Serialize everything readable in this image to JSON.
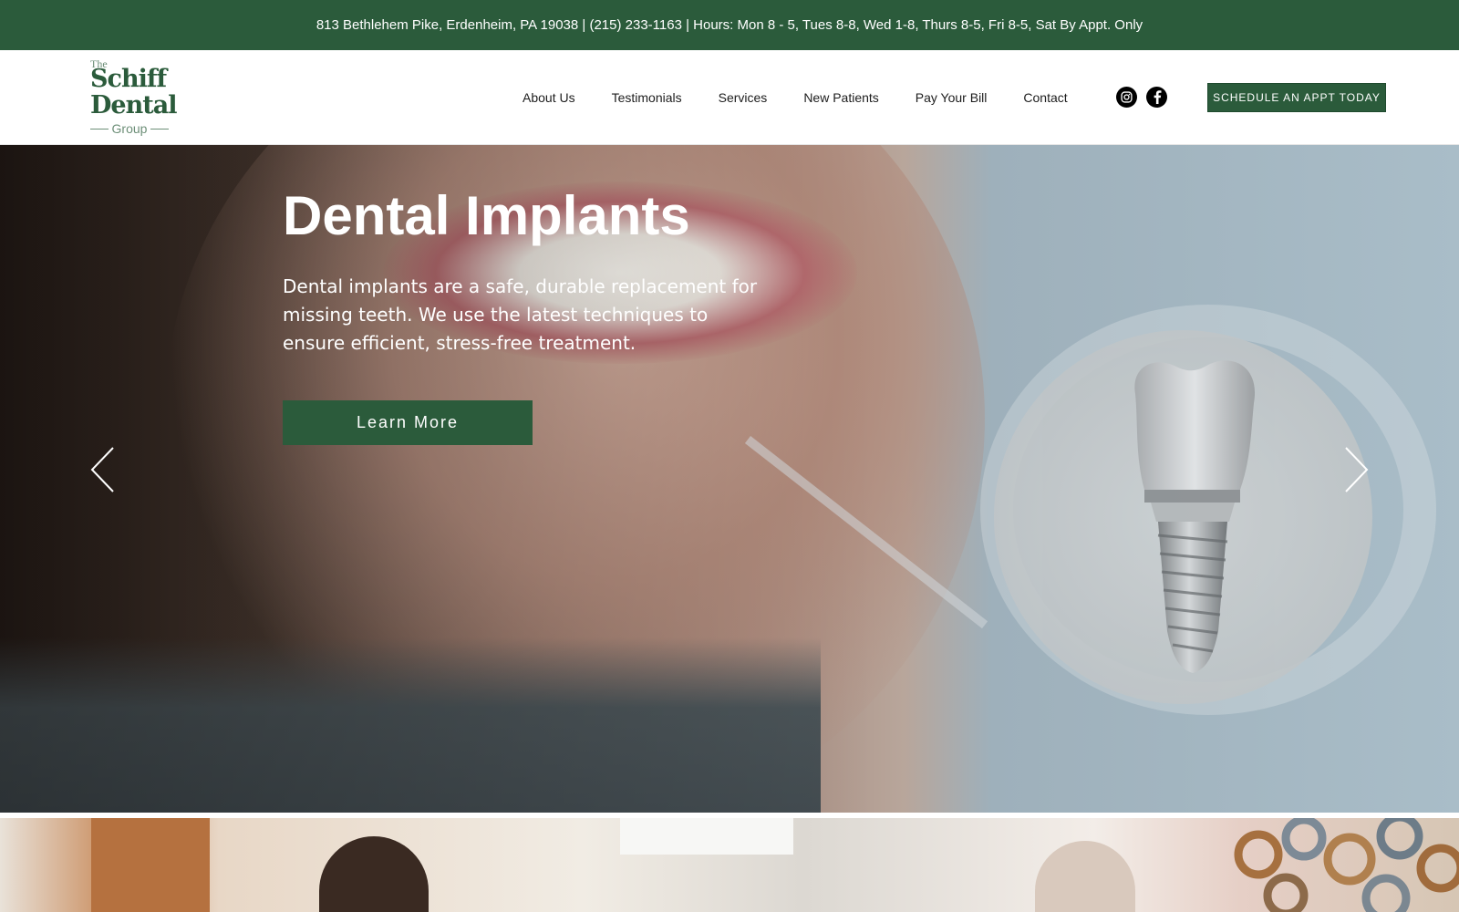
{
  "topbar": {
    "info": "813 Bethlehem Pike, Erdenheim, PA 19038  |  (215) 233-1163  |  Hours: Mon 8 - 5, Tues 8-8, Wed 1-8, Thurs 8-5, Fri 8-5, Sat By Appt. Only"
  },
  "header": {
    "logo": {
      "the": "The",
      "line1": "Schiff",
      "line2": "Dental",
      "line3": "Group"
    },
    "nav": [
      {
        "label": "About Us"
      },
      {
        "label": "Testimonials"
      },
      {
        "label": "Services"
      },
      {
        "label": "New Patients"
      },
      {
        "label": "Pay Your Bill"
      },
      {
        "label": "Contact"
      }
    ],
    "social": [
      "instagram-icon",
      "facebook-icon"
    ],
    "cta_label": "SCHEDULE AN APPT TODAY"
  },
  "hero": {
    "title": "Dental Implants",
    "text": "Dental implants are a safe, durable replacement for missing teeth. We use the latest techniques to ensure efficient, stress-free treatment.",
    "button_label": "Learn More",
    "prev_icon": "chevron-left-icon",
    "next_icon": "chevron-right-icon"
  },
  "colors": {
    "brand_green": "#2b5b3b",
    "white": "#ffffff"
  }
}
